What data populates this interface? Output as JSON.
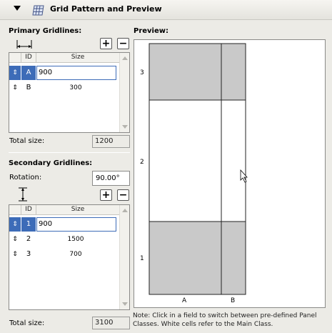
{
  "panel": {
    "title": "Grid Pattern and Preview"
  },
  "primary": {
    "heading": "Primary Gridlines:",
    "columns": [
      "ID",
      "Size"
    ],
    "rows": [
      {
        "id": "A",
        "size": "900",
        "selected": true
      },
      {
        "id": "B",
        "size": "300",
        "selected": false
      }
    ],
    "total_label": "Total size:",
    "total_value": "1200"
  },
  "secondary": {
    "heading": "Secondary Gridlines:",
    "rotation_label": "Rotation:",
    "rotation_value": "90.00°",
    "columns": [
      "ID",
      "Size"
    ],
    "rows": [
      {
        "id": "1",
        "size": "900",
        "selected": true
      },
      {
        "id": "2",
        "size": "1500",
        "selected": false
      },
      {
        "id": "3",
        "size": "700",
        "selected": false
      }
    ],
    "total_label": "Total size:",
    "total_value": "3100"
  },
  "preview": {
    "heading": "Preview:",
    "col_labels": [
      "A",
      "B"
    ],
    "row_labels": [
      "3",
      "2",
      "1"
    ],
    "note": "Note: Click in a field to switch between pre-defined Panel Classes. White cells refer to the Main Class.",
    "colors": {
      "gray_cell": "#c9c9c9",
      "white_cell": "#ffffff",
      "grid_line": "#222222"
    }
  },
  "icons": {
    "add": "+",
    "remove": "−",
    "updown": "⇕"
  }
}
